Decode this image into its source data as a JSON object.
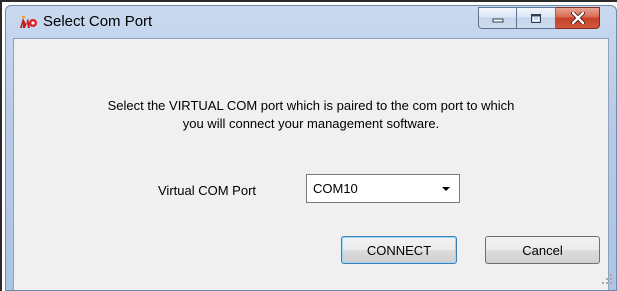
{
  "window": {
    "title": "Select Com Port",
    "app_icon": "mp-logo-icon"
  },
  "caption_buttons": {
    "minimize_icon": "minimize-icon",
    "maximize_icon": "maximize-icon",
    "close_icon": "close-icon"
  },
  "message": {
    "line1": "Select the VIRTUAL COM port which is paired to the com port to which",
    "line2": "you will connect your management software."
  },
  "port": {
    "label": "Virtual COM Port",
    "selected": "COM10"
  },
  "buttons": {
    "connect": "CONNECT",
    "cancel": "Cancel"
  },
  "colors": {
    "title_gradient": "#b6cbe6",
    "client_bg": "#f0f0f0",
    "close_red": "#c7412a"
  }
}
